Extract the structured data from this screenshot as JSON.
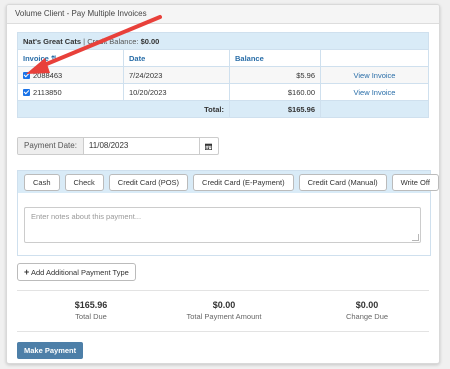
{
  "panel": {
    "title": "Volume Client - Pay Multiple Invoices"
  },
  "client": {
    "name": "Nat's Great Cats",
    "separator": " | ",
    "credit_label": "Credit Balance:",
    "credit_value": "$0.00"
  },
  "table": {
    "headers": [
      "Invoice ⇅",
      "Date",
      "Balance",
      ""
    ],
    "rows": [
      {
        "checked": true,
        "invoice": "2088463",
        "date": "7/24/2023",
        "balance": "$5.96",
        "action": "View Invoice"
      },
      {
        "checked": true,
        "invoice": "2113850",
        "date": "10/20/2023",
        "balance": "$160.00",
        "action": "View Invoice"
      }
    ],
    "total_label": "Total:",
    "total_value": "$165.96"
  },
  "payment_date": {
    "label": "Payment Date:",
    "value": "11/08/2023",
    "icon": "calendar-icon"
  },
  "payment_types": [
    "Cash",
    "Check",
    "Credit Card (POS)",
    "Credit Card (E-Payment)",
    "Credit Card (Manual)",
    "Write Off"
  ],
  "notes": {
    "placeholder": "Enter notes about this payment..."
  },
  "add_payment": {
    "icon": "plus-icon",
    "label": "Add Additional Payment Type"
  },
  "summary": [
    {
      "amount": "$165.96",
      "label": "Total Due"
    },
    {
      "amount": "$0.00",
      "label": "Total Payment Amount"
    },
    {
      "amount": "$0.00",
      "label": "Change Due"
    }
  ],
  "make_payment": {
    "label": "Make Payment"
  },
  "colors": {
    "accent": "#2a6ea8",
    "header_bg": "#d9ebf7",
    "primary_button": "#4d7fa8",
    "annotation_arrow": "#e8403a"
  }
}
